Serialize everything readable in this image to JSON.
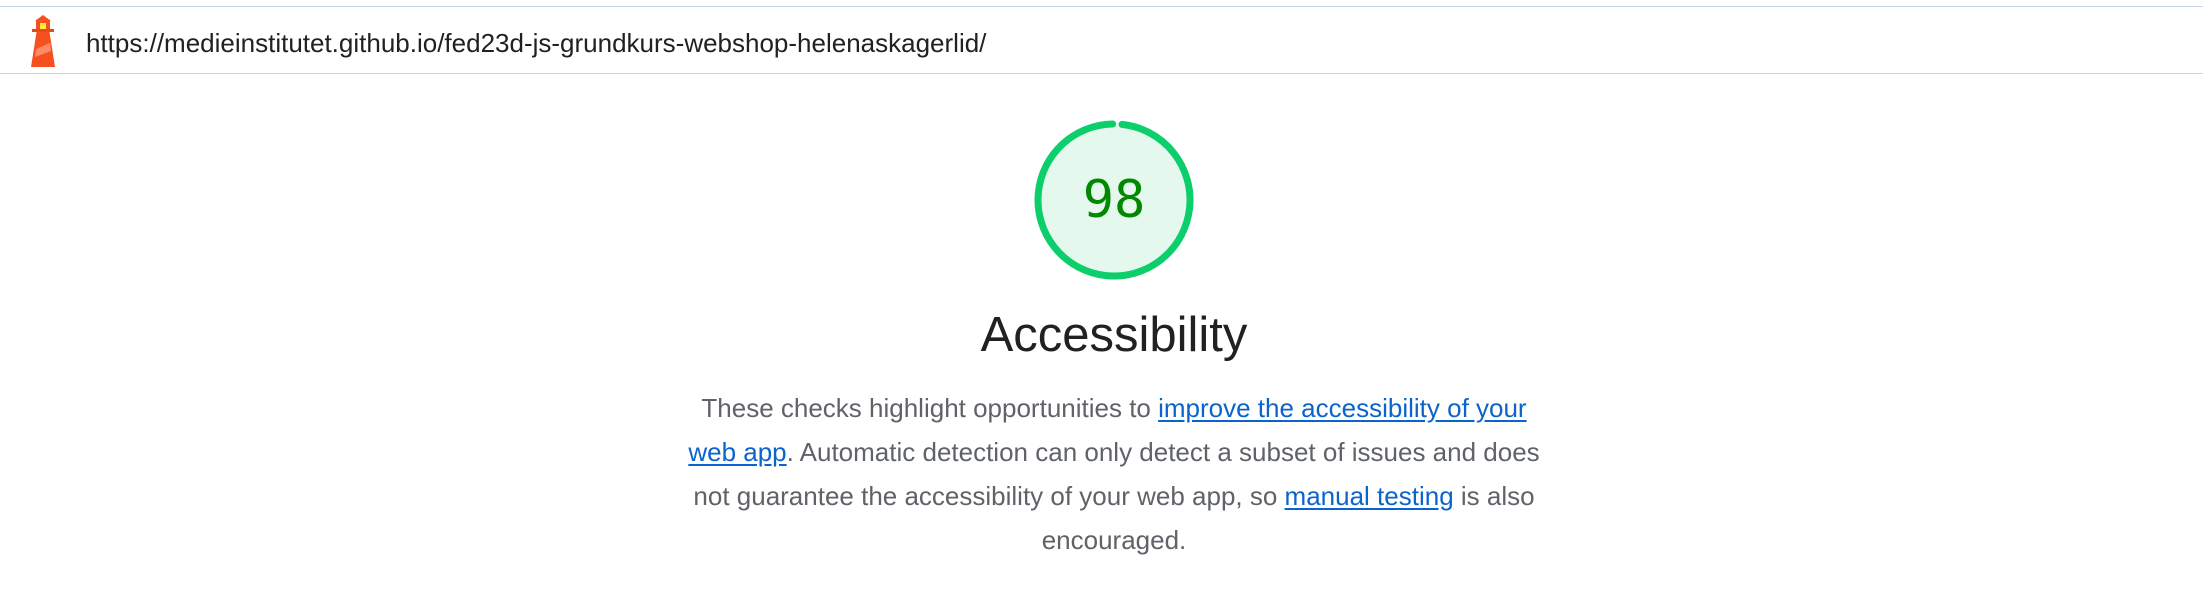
{
  "topbar": {
    "icon": "lighthouse-icon",
    "url": "https://medieinstitutet.github.io/fed23d-js-grundkurs-webshop-helenaskagerlid/"
  },
  "score": {
    "value": "98",
    "fraction": 0.98,
    "ring_color": "#0cce6b",
    "fill_color": "#e5f8ee",
    "text_color": "#008800"
  },
  "category": {
    "title": "Accessibility",
    "description_part1": "These checks highlight opportunities to ",
    "link1": "improve the accessibility of your web app",
    "description_part2": ". Automatic detection can only detect a subset of issues and does not guarantee the accessibility of your web app, so ",
    "link2": "manual testing",
    "description_part3": " is also encouraged."
  }
}
